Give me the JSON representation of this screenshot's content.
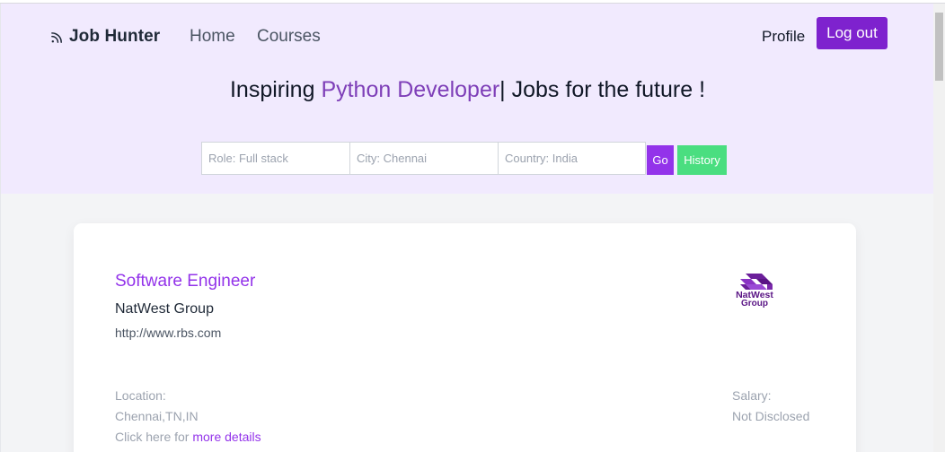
{
  "header": {
    "brand_name": "Job Hunter",
    "nav": [
      {
        "label": "Home"
      },
      {
        "label": "Courses"
      }
    ],
    "profile_label": "Profile",
    "logout_label": "Log out"
  },
  "headline": {
    "prefix": "Inspiring ",
    "typed_text": "Python Developer",
    "caret": "|",
    "suffix": " Jobs for the future !"
  },
  "search": {
    "role_placeholder": "Role: Full stack",
    "city_placeholder": "City: Chennai",
    "country_placeholder": "Country: India",
    "go_label": "Go",
    "history_label": "History"
  },
  "job": {
    "title": "Software Engineer",
    "company": "NatWest Group",
    "website": "http://www.rbs.com",
    "logo_line1": "NatWest",
    "logo_line2": "Group",
    "location_label": "Location:",
    "location_value": "Chennai,TN,IN",
    "details_prefix": "Click here for ",
    "details_link": "more details",
    "salary_label": "Salary:",
    "salary_value": "Not Disclosed"
  },
  "colors": {
    "hero_bg": "#f1eafe",
    "accent_purple": "#7e22ce",
    "go_button": "#9333ea",
    "history_button": "#4ade80"
  }
}
